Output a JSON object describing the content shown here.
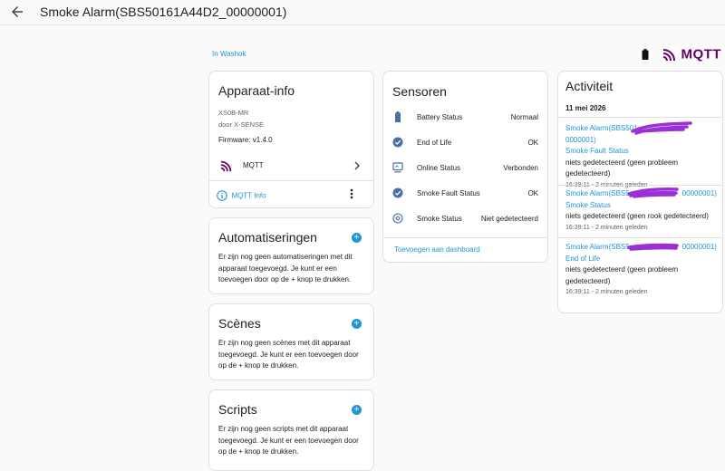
{
  "header": {
    "title": "Smoke Alarm(SBS50161A44D2_00000001)"
  },
  "area_link": "In Washok",
  "integration": {
    "logo_text": "MQTT"
  },
  "device_info": {
    "heading": "Apparaat-info",
    "model": "XS0B-MR",
    "manufacturer": "door X-SENSE",
    "firmware": "Firmware: v1.4.0",
    "integration_label": "MQTT",
    "mqtt_info_label": "MQTT Info"
  },
  "automations": {
    "heading": "Automatiseringen",
    "text": "Er zijn nog geen automatiseringen met dit apparaat toegevoegd. Je kunt er een toevoegen door op de + knop te drukken."
  },
  "scenes": {
    "heading": "Scènes",
    "text": "Er zijn nog geen scènes met dit apparaat toegevoegd. Je kunt er een toevoegen door op de + knop te drukken."
  },
  "scripts": {
    "heading": "Scripts",
    "text": "Er zijn nog geen scripts met dit apparaat toegevoegd. Je kunt er een toevoegen door op de + knop te drukken."
  },
  "sensors": {
    "heading": "Sensoren",
    "rows": [
      {
        "label": "Battery Status",
        "value": "Normaal",
        "icon": "battery-icon"
      },
      {
        "label": "End of Life",
        "value": "OK",
        "icon": "check-circle-icon"
      },
      {
        "label": "Online Status",
        "value": "Verbonden",
        "icon": "monitor-icon"
      },
      {
        "label": "Smoke Fault Status",
        "value": "OK",
        "icon": "check-circle-icon"
      },
      {
        "label": "Smoke Status",
        "value": "Niet gedetecteerd",
        "icon": "smoke-detector-icon"
      }
    ],
    "add_to_dashboard": "Toevoegen aan dashboard"
  },
  "activity": {
    "heading": "Activiteit",
    "date": "11 mei 2026",
    "items": [
      {
        "device": "Smoke Alarm(SBS501",
        "device_tail": "0000001)",
        "entity": "Smoke Fault Status",
        "message": "niets gedetecteerd (geen probleem gedetecteerd)",
        "time": "16:39:11 - 2 minuten geleden"
      },
      {
        "device": "Smoke Alarm(SBS5",
        "device_tail": "00000001)",
        "entity": "Smoke Status",
        "message": "niets gedetecteerd (geen rook gedetecteerd)",
        "time": "16:39:11 - 2 minuten geleden"
      },
      {
        "device": "Smoke Alarm(SBS5",
        "device_tail": "00000001)",
        "entity": "End of Life",
        "message": "niets gedetecteerd (geen probleem gedetecteerd)",
        "time": "16:39:11 - 2 minuten geleden"
      }
    ]
  },
  "colors": {
    "accent": "#2196d3",
    "mqtt": "#660066",
    "redaction": "#9b30d9"
  }
}
